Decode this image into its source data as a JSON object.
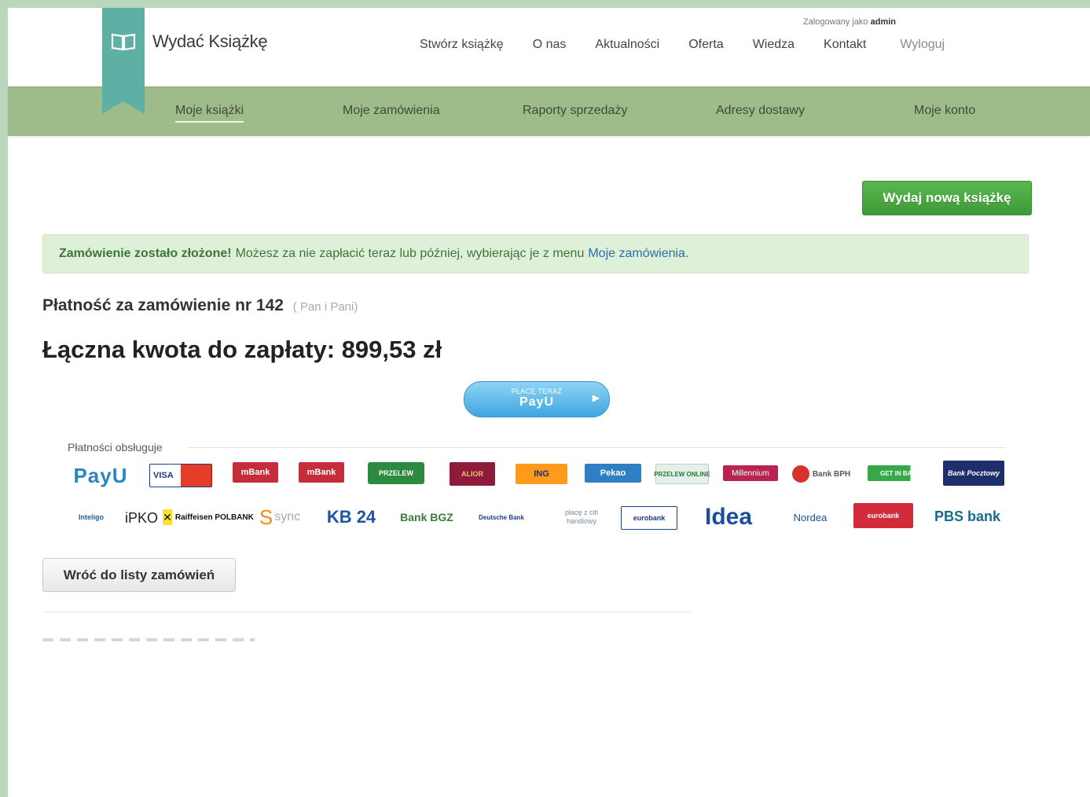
{
  "brand": {
    "name": "Wydać Książkę",
    "icon": "open-book-icon"
  },
  "user": {
    "prefix": "Zalogowany jako",
    "name": "admin"
  },
  "topnav": [
    "Stwórz książkę",
    "O nas",
    "Aktualności",
    "Oferta",
    "Wiedza",
    "Kontakt"
  ],
  "logout": "Wyloguj",
  "subnav": [
    "Moje książki",
    "Moje zamówienia",
    "Raporty sprzedaży",
    "Adresy dostawy",
    "Moje konto"
  ],
  "new_book_button": "Wydaj nową książkę",
  "alert": {
    "strong": "Zamówienie zostało złożone!",
    "text": "Możesz za nie zapłacić teraz lub później, wybierając je z menu",
    "link": "Moje zamówienia",
    "end": "."
  },
  "order": {
    "title": "Płatność za zamówienie nr 142",
    "customer": "( Pan i Pani)"
  },
  "total": "Łączna kwota do zapłaty: 899,53 zł",
  "pay_button": {
    "top": "PŁACĘ TERAZ",
    "brand": "PayU"
  },
  "methods_label": "Płatności obsługuje",
  "methods": [
    "PayU",
    "VISA",
    "mBank",
    "mBank",
    "PRZELEW",
    "ALIOR",
    "ING",
    "Pekao",
    "PRZELEW ONLINE",
    "Millennium",
    "Bank BPH",
    "GET IN BANK",
    "Bank Pocztowy",
    "Inteligo",
    "iPKO",
    "Raiffeisen POLBANK",
    "sync",
    "KB 24",
    "Bank BGZ",
    "Deutsche Bank",
    "płacę z citi handlowy",
    "eurobank",
    "Idea",
    "Nordea",
    "eurobank",
    "PBS bank"
  ],
  "back_button": "Wróć do listy zamówień",
  "colors": {
    "background": "#b9d7bc",
    "subnav": "#9dbc8a",
    "ribbon": "#5fb0a4",
    "accent_green": "#4cab44",
    "alert_bg": "#dff0d8",
    "link": "#2a6db0"
  }
}
